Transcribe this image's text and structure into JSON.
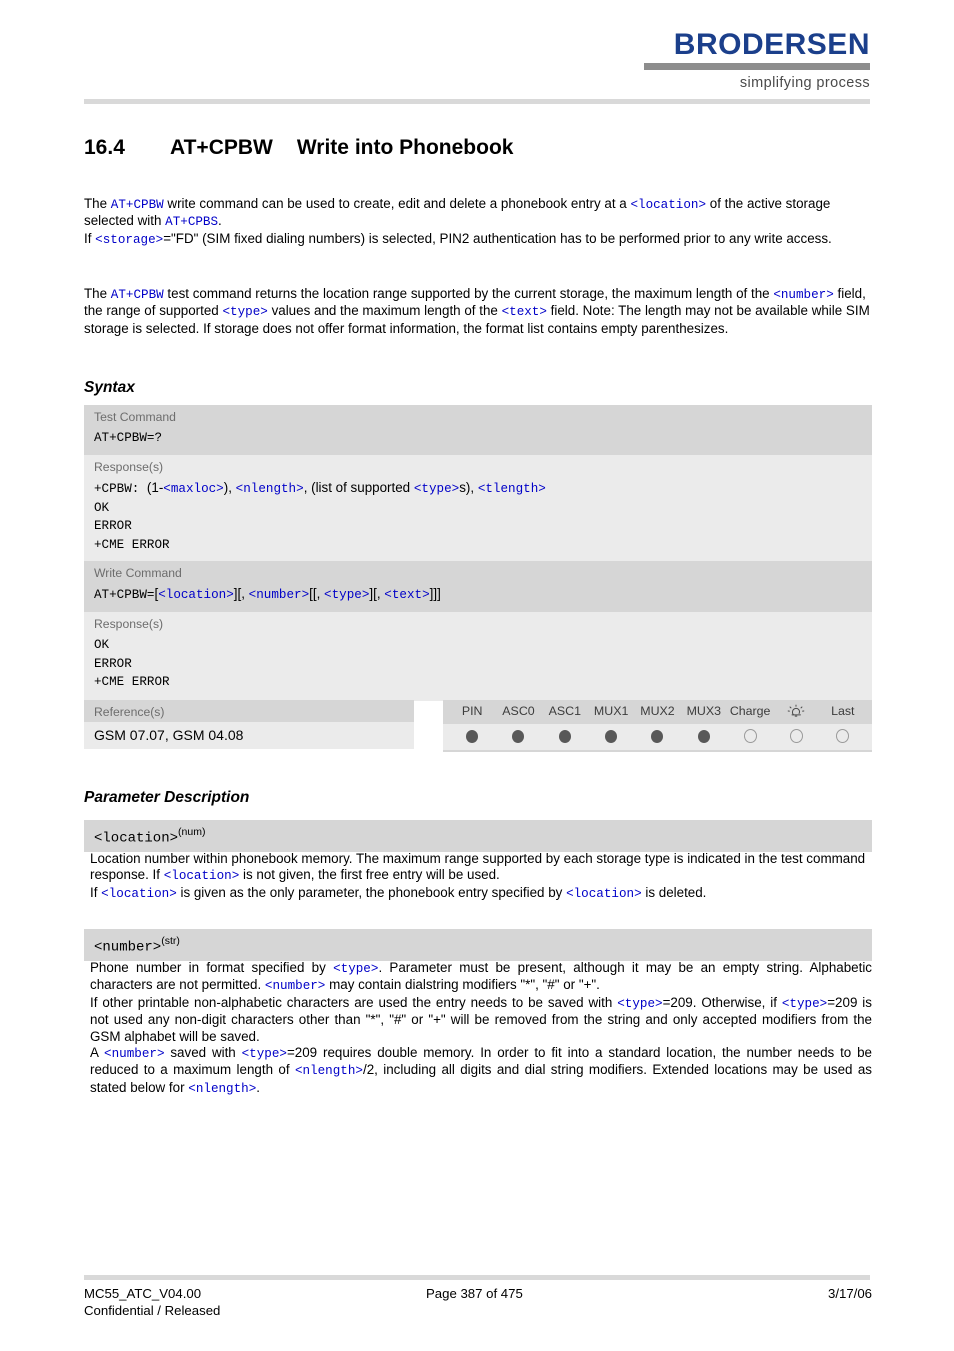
{
  "brand": {
    "name": "BRODERSEN",
    "tagline": "simplifying process"
  },
  "heading": {
    "number": "16.4",
    "command": "AT+CPBW",
    "title": "Write into Phonebook"
  },
  "intro": {
    "paragraph1_html": "The <code>AT+CPBW</code> write command can be used to create, edit and delete a phonebook entry at a <code>&lt;location&gt;</code> of the active storage selected with <code>AT+CPBS</code>.<br>If <code>&lt;storage&gt;</code>=\"FD\" (SIM fixed dialing numbers) is selected, PIN2 authentication has to be performed prior to any write access.",
    "paragraph2_html": "The <code>AT+CPBW</code> test command returns the location range supported by the current storage, the maximum length of the <code>&lt;number&gt;</code> field, the range of supported <code>&lt;type&gt;</code> values and the maximum length of the <code>&lt;text&gt;</code> field. Note: The length may not be available while SIM storage is selected. If storage does not offer format information, the format list contains empty parenthesizes."
  },
  "sections": {
    "syntax_heading": "Syntax",
    "parameter_heading": "Parameter Description"
  },
  "syntax": {
    "test": {
      "title": "Test Command",
      "command_html": "<code class=\"blk\">AT+CPBW=?</code>",
      "response_title": "Response(s)",
      "response_html": "<code class=\"blk\">+CPBW: </code><span class=\"sansbit\">(1-</span><code>&lt;maxloc&gt;</code><span class=\"sansbit\">), </span><code>&lt;nlength&gt;</code><span class=\"sansbit\">, (list of supported </span><code>&lt;type&gt;</code><span class=\"sansbit\">s), </span><code>&lt;tlength&gt;</code><br><code class=\"blk\">OK</code><br><code class=\"blk\">ERROR</code><br><code class=\"blk\">+CME ERROR</code>"
    },
    "write": {
      "title": "Write Command",
      "command_html": "<code class=\"blk\">AT+CPBW=</code><span class=\"sansbit\">[</span><code>&lt;location&gt;</code><span class=\"sansbit\">][, </span><code>&lt;number&gt;</code><span class=\"sansbit\">[[, </span><code>&lt;type&gt;</code><span class=\"sansbit\">][, </span><code>&lt;text&gt;</code><span class=\"sansbit\">]]]</span>",
      "response_title": "Response(s)",
      "response_html": "<code class=\"blk\">OK</code><br><code class=\"blk\">ERROR</code><br><code class=\"blk\">+CME ERROR</code>"
    }
  },
  "reference": {
    "title": "Reference(s)",
    "value": "GSM 07.07, GSM 04.08"
  },
  "support_matrix": {
    "columns": [
      {
        "label": "PIN",
        "icon": null,
        "supported": true
      },
      {
        "label": "ASC0",
        "icon": null,
        "supported": true
      },
      {
        "label": "ASC1",
        "icon": null,
        "supported": true
      },
      {
        "label": "MUX1",
        "icon": null,
        "supported": true
      },
      {
        "label": "MUX2",
        "icon": null,
        "supported": true
      },
      {
        "label": "MUX3",
        "icon": null,
        "supported": true
      },
      {
        "label": "Charge",
        "icon": null,
        "supported": false
      },
      {
        "label": "",
        "icon": "alarm-bell-icon",
        "supported": false
      },
      {
        "label": "Last",
        "icon": null,
        "supported": false
      }
    ]
  },
  "parameters": [
    {
      "name": "<location>",
      "type": "(num)",
      "body_html": "Location number within phonebook memory. The maximum range supported by each storage type is indicated in the test command response. If <code>&lt;location&gt;</code> is not given, the first free entry will be used.<br>If <code>&lt;location&gt;</code> is given as the only parameter, the phonebook entry specified by <code>&lt;location&gt;</code> is deleted."
    },
    {
      "name": "<number>",
      "type": "(str)",
      "body_html": "Phone number in format specified by <code>&lt;type&gt;</code>. Parameter must be present, although it may be an empty string. Alphabetic characters are not permitted. <code>&lt;number&gt;</code> may contain dialstring modifiers \"*\", \"#\" or \"+\".<br>If other printable non-alphabetic characters are used the entry needs to be saved with <code>&lt;type&gt;</code>=209. Otherwise, if <code>&lt;type&gt;</code>=209 is not used any non-digit characters other than \"*\", \"#\" or \"+\" will be removed from the string and only accepted modifiers from the GSM alphabet will be saved.<br>A <code>&lt;number&gt;</code> saved with <code>&lt;type&gt;</code>=209 requires double memory. In order to fit into a standard location, the number needs to be reduced to a maximum length of <code>&lt;nlength&gt;</code>/2, including all digits and dial string modifiers. Extended locations may be used as stated below for <code>&lt;nlength&gt;</code>."
    }
  ],
  "footer": {
    "document_id": "MC55_ATC_V04.00",
    "classification": "Confidential / Released",
    "page": "Page 387 of 475",
    "date": "3/17/06"
  },
  "colors": {
    "brand_blue": "#1b3f8b",
    "code_blue": "#0000c8",
    "header_gray": "#d6d6d6",
    "response_gray": "#ebebeb",
    "rule_gray": "#d9d9d9"
  }
}
